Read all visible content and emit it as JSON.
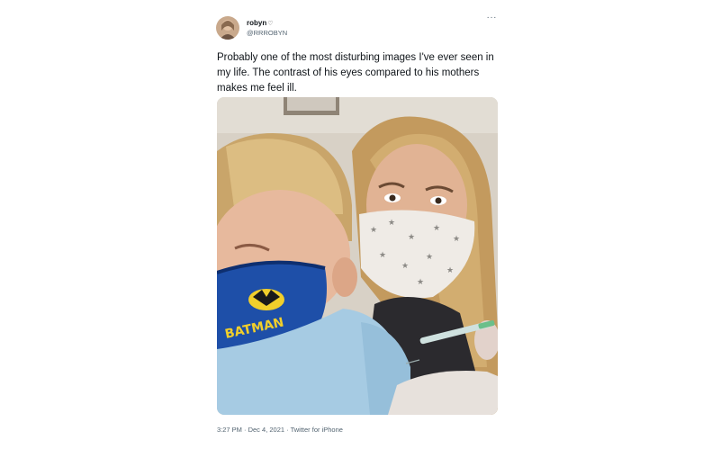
{
  "tweet": {
    "display_name": "robyn",
    "handle": "@RRROBYN",
    "text": "Probably one of the most disturbing images I've ever seen in my life. The contrast of his eyes compared to his mothers makes me feel ill.",
    "more_icon": "more-horizontal-icon",
    "mask_text": "BATMAN",
    "timestamp": "3:27 PM · Dec 4, 2021 · Twitter for iPhone"
  }
}
